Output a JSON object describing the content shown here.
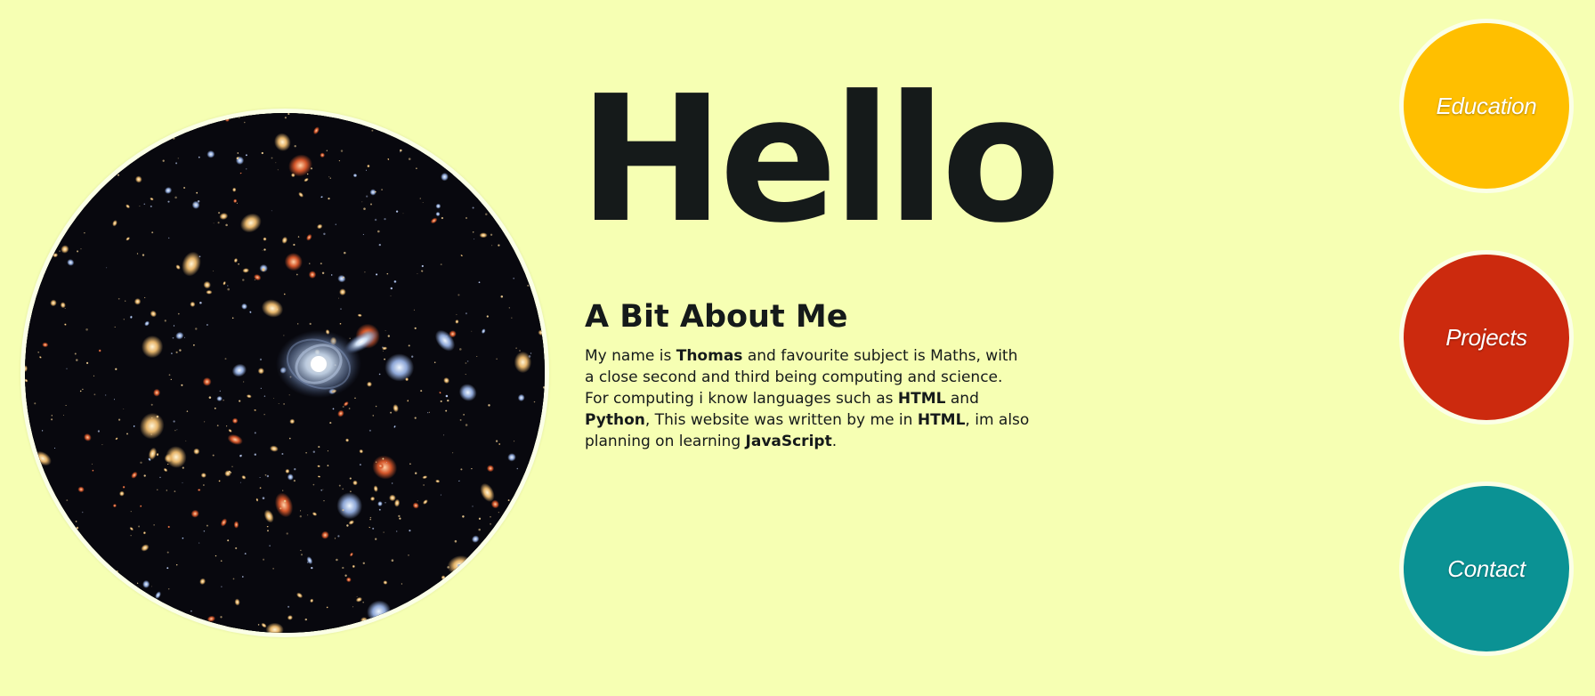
{
  "hero": {
    "greeting": "Hello"
  },
  "about": {
    "title": "A Bit About Me",
    "paragraph": [
      {
        "text": "My name is ",
        "bold": false
      },
      {
        "text": "Thomas",
        "bold": true
      },
      {
        "text": " and favourite subject is Maths, with a close second and third being computing and science. For computing i know languages such as ",
        "bold": false
      },
      {
        "text": "HTML",
        "bold": true
      },
      {
        "text": " and ",
        "bold": false
      },
      {
        "text": "Python",
        "bold": true
      },
      {
        "text": ", This website was written by me in ",
        "bold": false
      },
      {
        "text": "HTML",
        "bold": true
      },
      {
        "text": ", im also planning on learning ",
        "bold": false
      },
      {
        "text": "JavaScript",
        "bold": true
      },
      {
        "text": ".",
        "bold": false
      }
    ]
  },
  "nav": {
    "education": {
      "label": "Education",
      "color": "#ffbf00"
    },
    "projects": {
      "label": "Projects",
      "color": "#cc2a0e"
    },
    "contact": {
      "label": "Contact",
      "color": "#0b9294"
    }
  },
  "colors": {
    "background": "#f6ffb3",
    "text": "#151a1a",
    "ring": "#fbffe6"
  },
  "portrait": {
    "icon": "galaxy-field-image"
  }
}
